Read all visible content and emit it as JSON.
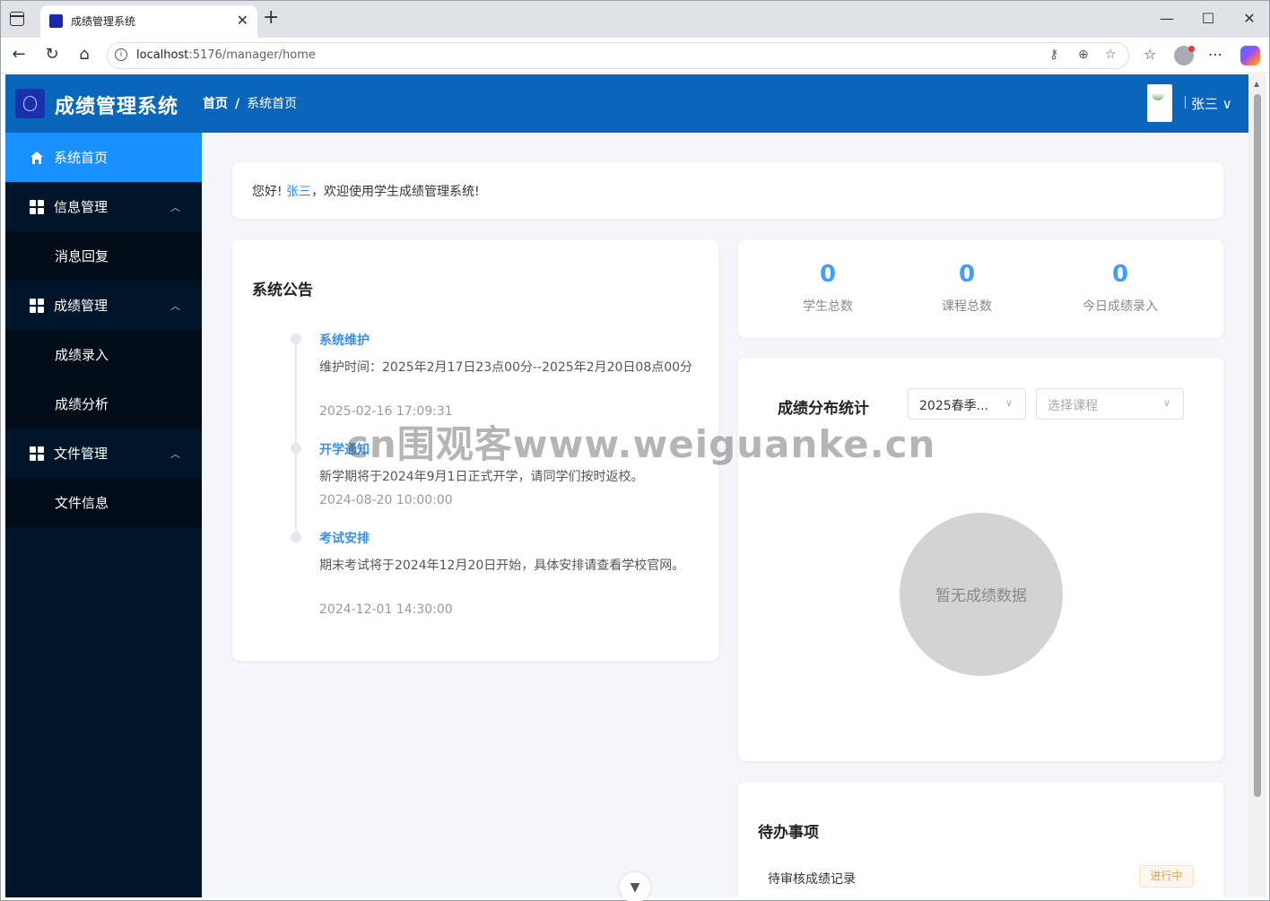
{
  "browser": {
    "tab_title": "成绩管理系统",
    "url_host": "localhost",
    "url_path": ":5176/manager/home"
  },
  "header": {
    "app_title": "成绩管理系统",
    "breadcrumb": [
      "首页",
      "系统首页"
    ],
    "breadcrumb_sep": "/",
    "user_name": "张三"
  },
  "sidebar": {
    "items": [
      {
        "label": "系统首页"
      },
      {
        "label": "信息管理"
      },
      {
        "label": "消息回复"
      },
      {
        "label": "成绩管理"
      },
      {
        "label": "成绩录入"
      },
      {
        "label": "成绩分析"
      },
      {
        "label": "文件管理"
      },
      {
        "label": "文件信息"
      }
    ]
  },
  "welcome": {
    "prefix": "您好! ",
    "name": "张三",
    "suffix": "，欢迎使用学生成绩管理系统!"
  },
  "notice": {
    "title": "系统公告",
    "items": [
      {
        "title": "系统维护",
        "body": "维护时间：2025年2月17日23点00分--2025年2月20日08点00分",
        "time": "2025-02-16 17:09:31"
      },
      {
        "title": "开学通知",
        "body": "新学期将于2024年9月1日正式开学，请同学们按时返校。",
        "time": "2024-08-20 10:00:00"
      },
      {
        "title": "考试安排",
        "body": "期末考试将于2024年12月20日开始，具体安排请查看学校官网。",
        "time": "2024-12-01 14:30:00"
      }
    ]
  },
  "stats": [
    {
      "value": "0",
      "label": "学生总数"
    },
    {
      "value": "0",
      "label": "课程总数"
    },
    {
      "value": "0",
      "label": "今日成绩录入"
    }
  ],
  "distribution": {
    "title": "成绩分布统计",
    "term_select": "2025春季...",
    "course_placeholder": "选择课程",
    "empty_text": "暂无成绩数据"
  },
  "todo": {
    "title": "待办事项",
    "items": [
      {
        "label": "待审核成绩记录",
        "status": "进行中"
      }
    ]
  },
  "watermark": "cn围观客www.weiguanke.cn",
  "colors": {
    "header_bg": "#0a66bb",
    "sidebar_bg": "#001529",
    "active_menu": "#1890ff",
    "accent": "#409eff",
    "tag_warning": "#e6a23c"
  }
}
